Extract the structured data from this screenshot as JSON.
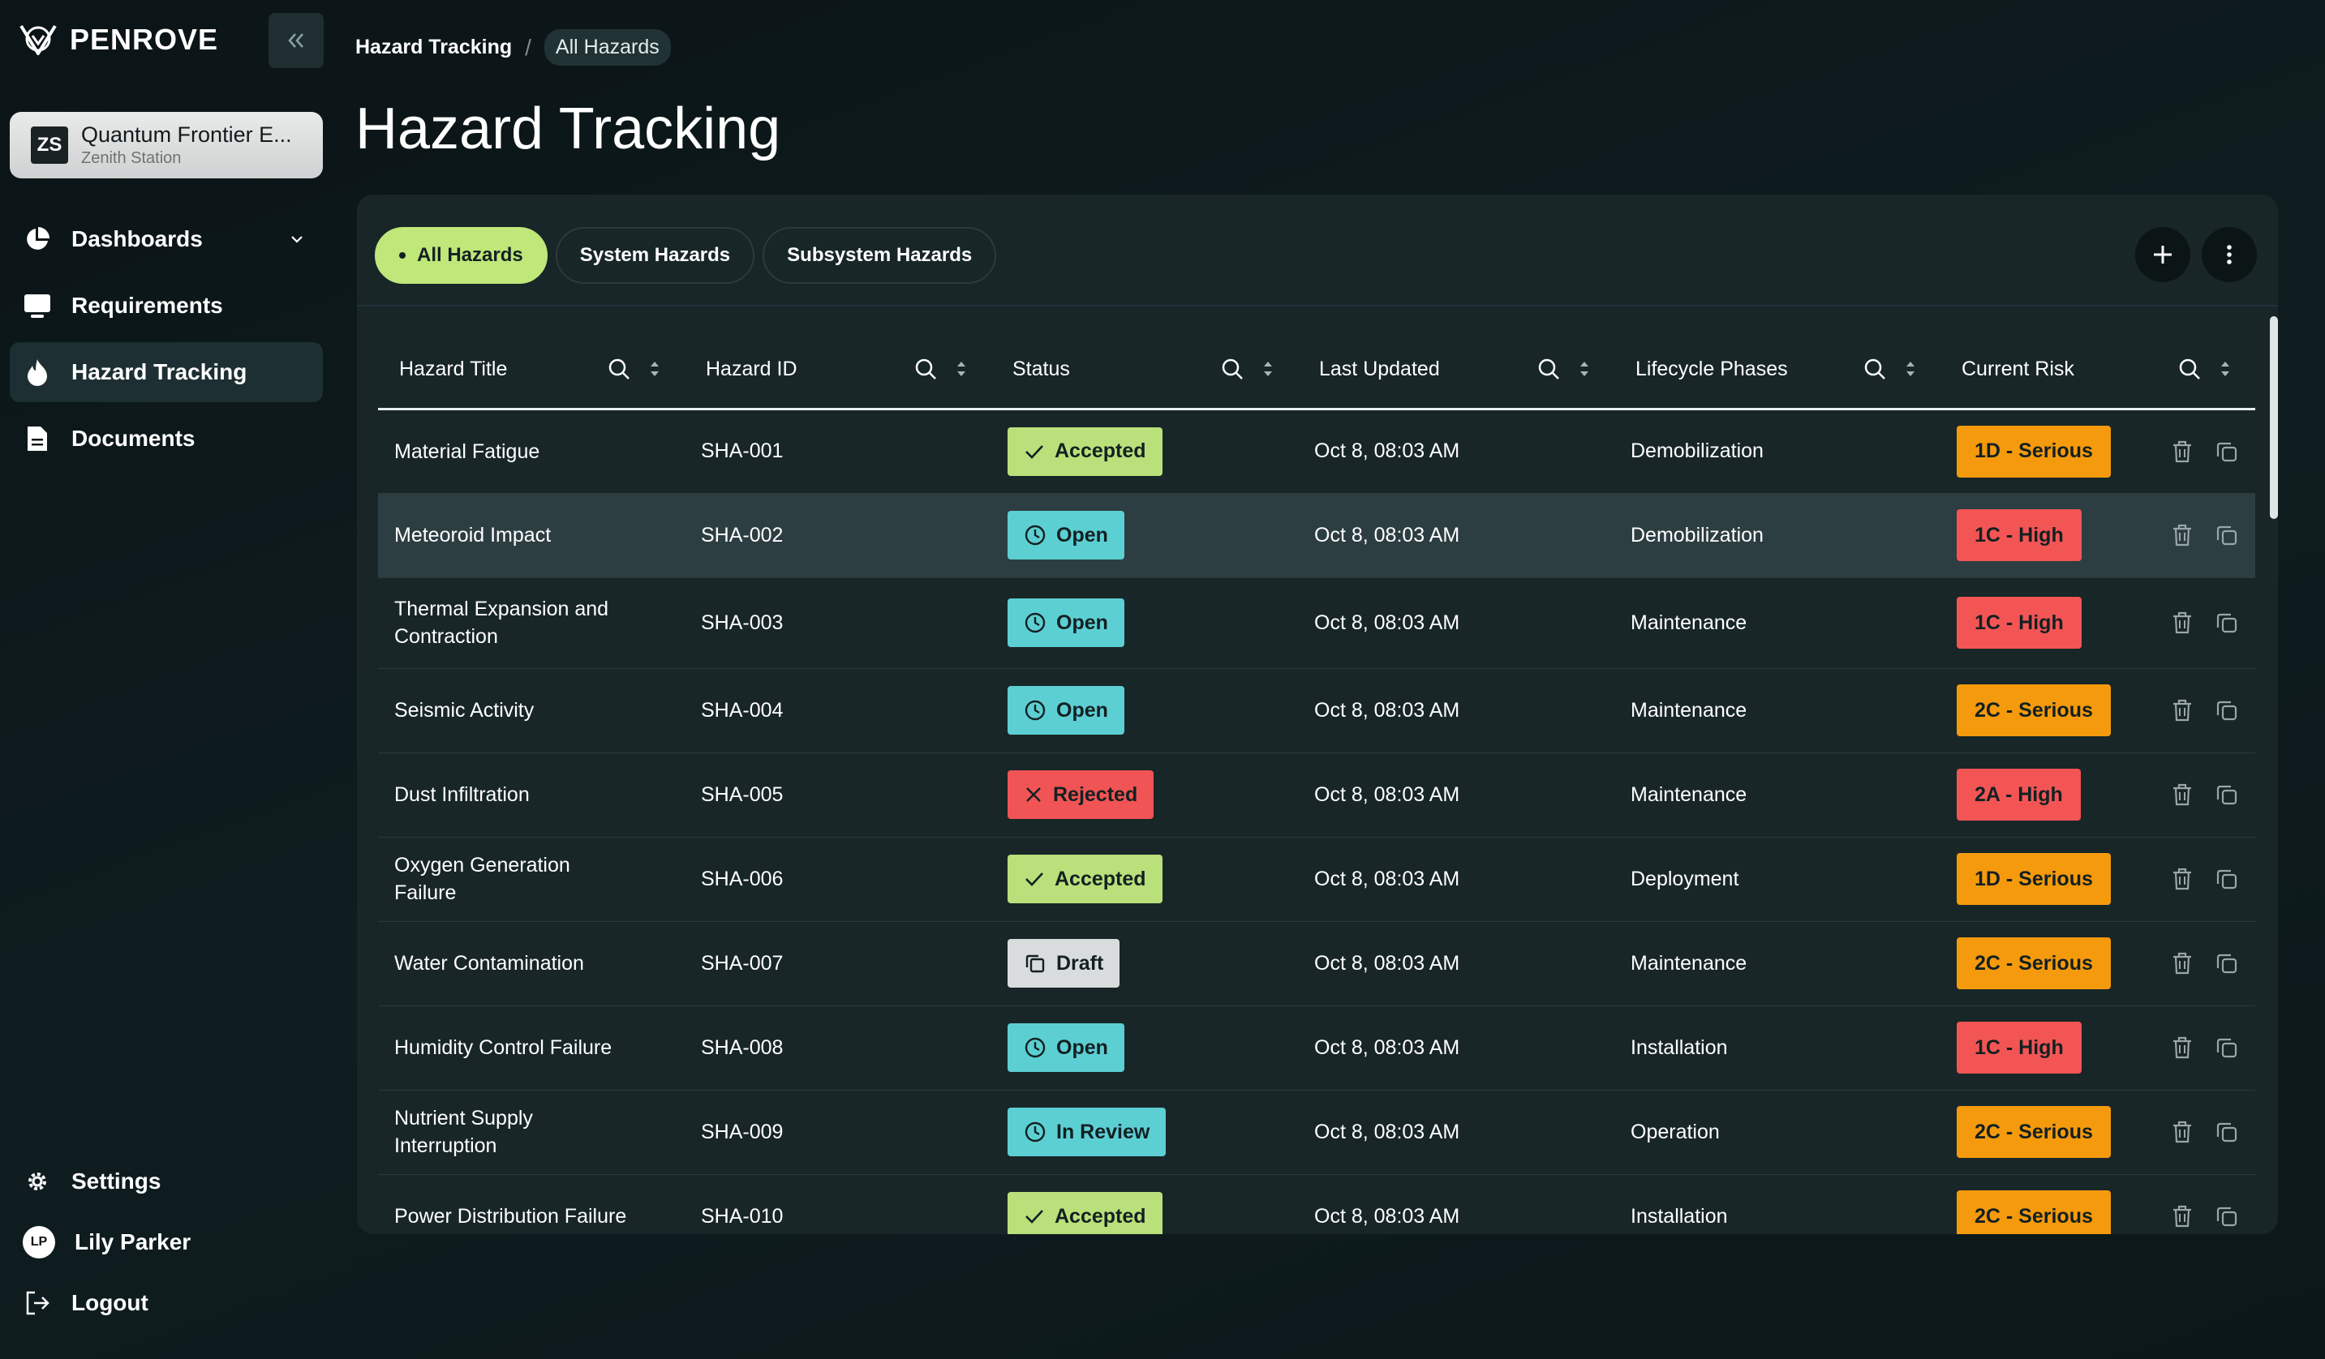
{
  "brand": {
    "name": "PENROVE"
  },
  "org": {
    "avatar": "ZS",
    "name": "Quantum Frontier E...",
    "station": "Zenith Station"
  },
  "nav": {
    "items": [
      {
        "label": "Dashboards",
        "icon": "pie-chart-icon"
      },
      {
        "label": "Requirements",
        "icon": "monitor-icon"
      },
      {
        "label": "Hazard Tracking",
        "icon": "flame-icon"
      },
      {
        "label": "Documents",
        "icon": "document-icon"
      }
    ],
    "settings": "Settings",
    "user": {
      "initials": "LP",
      "name": "Lily Parker"
    },
    "logout": "Logout"
  },
  "breadcrumb": {
    "parent": "Hazard Tracking",
    "current": "All Hazards"
  },
  "page": {
    "title": "Hazard Tracking"
  },
  "tabs": [
    "All Hazards",
    "System Hazards",
    "Subsystem Hazards"
  ],
  "table": {
    "headers": [
      "Hazard Title",
      "Hazard ID",
      "Status",
      "Last Updated",
      "Lifecycle Phases",
      "Current Risk"
    ],
    "rows": [
      {
        "title": "Material Fatigue",
        "id": "SHA-001",
        "status": "Accepted",
        "updated": "Oct 8, 08:03 AM",
        "phase": "Demobilization",
        "risk": "1D - Serious"
      },
      {
        "title": "Meteoroid Impact",
        "id": "SHA-002",
        "status": "Open",
        "updated": "Oct 8, 08:03 AM",
        "phase": "Demobilization",
        "risk": "1C - High"
      },
      {
        "title": "Thermal Expansion and Contraction",
        "id": "SHA-003",
        "status": "Open",
        "updated": "Oct 8, 08:03 AM",
        "phase": "Maintenance",
        "risk": "1C - High"
      },
      {
        "title": "Seismic Activity",
        "id": "SHA-004",
        "status": "Open",
        "updated": "Oct 8, 08:03 AM",
        "phase": "Maintenance",
        "risk": "2C - Serious"
      },
      {
        "title": "Dust Infiltration",
        "id": "SHA-005",
        "status": "Rejected",
        "updated": "Oct 8, 08:03 AM",
        "phase": "Maintenance",
        "risk": "2A - High"
      },
      {
        "title": "Oxygen Generation Failure",
        "id": "SHA-006",
        "status": "Accepted",
        "updated": "Oct 8, 08:03 AM",
        "phase": "Deployment",
        "risk": "1D - Serious"
      },
      {
        "title": "Water Contamination",
        "id": "SHA-007",
        "status": "Draft",
        "updated": "Oct 8, 08:03 AM",
        "phase": "Maintenance",
        "risk": "2C - Serious"
      },
      {
        "title": "Humidity Control Failure",
        "id": "SHA-008",
        "status": "Open",
        "updated": "Oct 8, 08:03 AM",
        "phase": "Installation",
        "risk": "1C - High"
      },
      {
        "title": "Nutrient Supply Interruption",
        "id": "SHA-009",
        "status": "In Review",
        "updated": "Oct 8, 08:03 AM",
        "phase": "Operation",
        "risk": "2C - Serious"
      },
      {
        "title": "Power Distribution Failure",
        "id": "SHA-010",
        "status": "Accepted",
        "updated": "Oct 8, 08:03 AM",
        "phase": "Installation",
        "risk": "2C - Serious"
      }
    ]
  },
  "colors": {
    "accepted": "#b9e07a",
    "open": "#5ccfd3",
    "rejected": "#f05454",
    "draft": "#d9dcdc",
    "serious": "#f59a0c",
    "high": "#f35555",
    "accent": "#bfe77a"
  }
}
